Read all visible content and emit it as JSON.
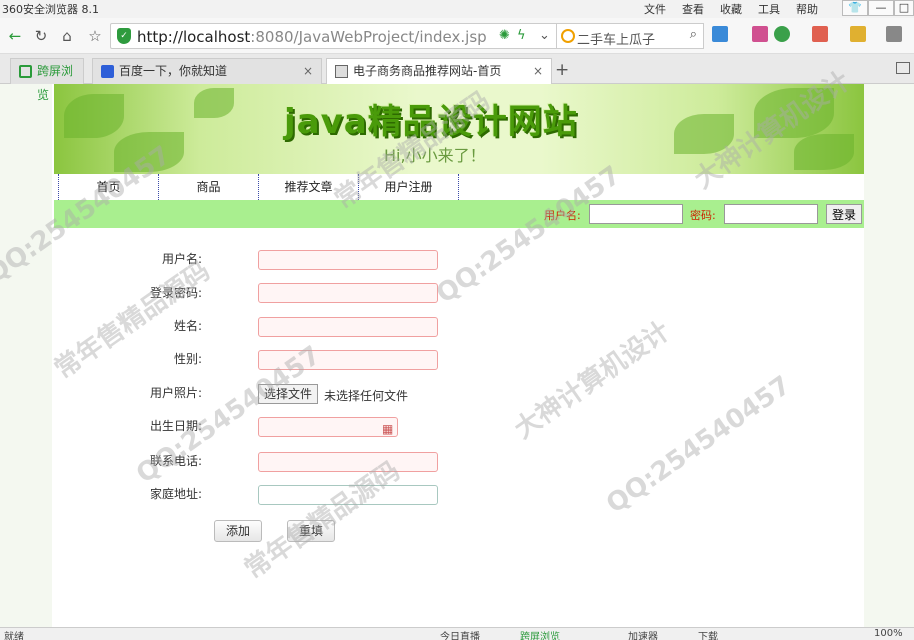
{
  "browser": {
    "app_title": "360安全浏览器 8.1",
    "menus": [
      "文件",
      "查看",
      "收藏",
      "工具",
      "帮助"
    ],
    "url_host": "http://localhost",
    "url_rest": ":8080/JavaWebProject/index.jsp",
    "search_text": "二手车上瓜子",
    "tabs": [
      {
        "label": "跨屏浏览"
      },
      {
        "label": "百度一下，你就知道"
      },
      {
        "label": "电子商务商品推荐网站-首页"
      }
    ],
    "status": {
      "left": "就绪",
      "items": [
        "今日直播",
        "跨屏浏览",
        "加速器",
        "下载",
        "100%"
      ]
    }
  },
  "site": {
    "title": "java精品设计网站",
    "subtitle": "Hi,小小来了！",
    "nav": [
      "首页",
      "商品",
      "推荐文章",
      "用户注册"
    ],
    "login": {
      "username_label": "用户名:",
      "password_label": "密码:",
      "login_btn": "登录"
    }
  },
  "form": {
    "fields": [
      {
        "label": "用户名:",
        "type": "text"
      },
      {
        "label": "登录密码:",
        "type": "password"
      },
      {
        "label": "姓名:",
        "type": "text"
      },
      {
        "label": "性别:",
        "type": "text"
      },
      {
        "label": "用户照片:",
        "type": "file"
      },
      {
        "label": "出生日期:",
        "type": "date"
      },
      {
        "label": "联系电话:",
        "type": "text"
      },
      {
        "label": "家庭地址:",
        "type": "text"
      }
    ],
    "file_btn": "选择文件",
    "file_none": "未选择任何文件",
    "submit": "添加",
    "reset": "重填"
  },
  "watermark": [
    "QQ:254540457",
    "大神计算机设计",
    "常年售精品源码"
  ]
}
